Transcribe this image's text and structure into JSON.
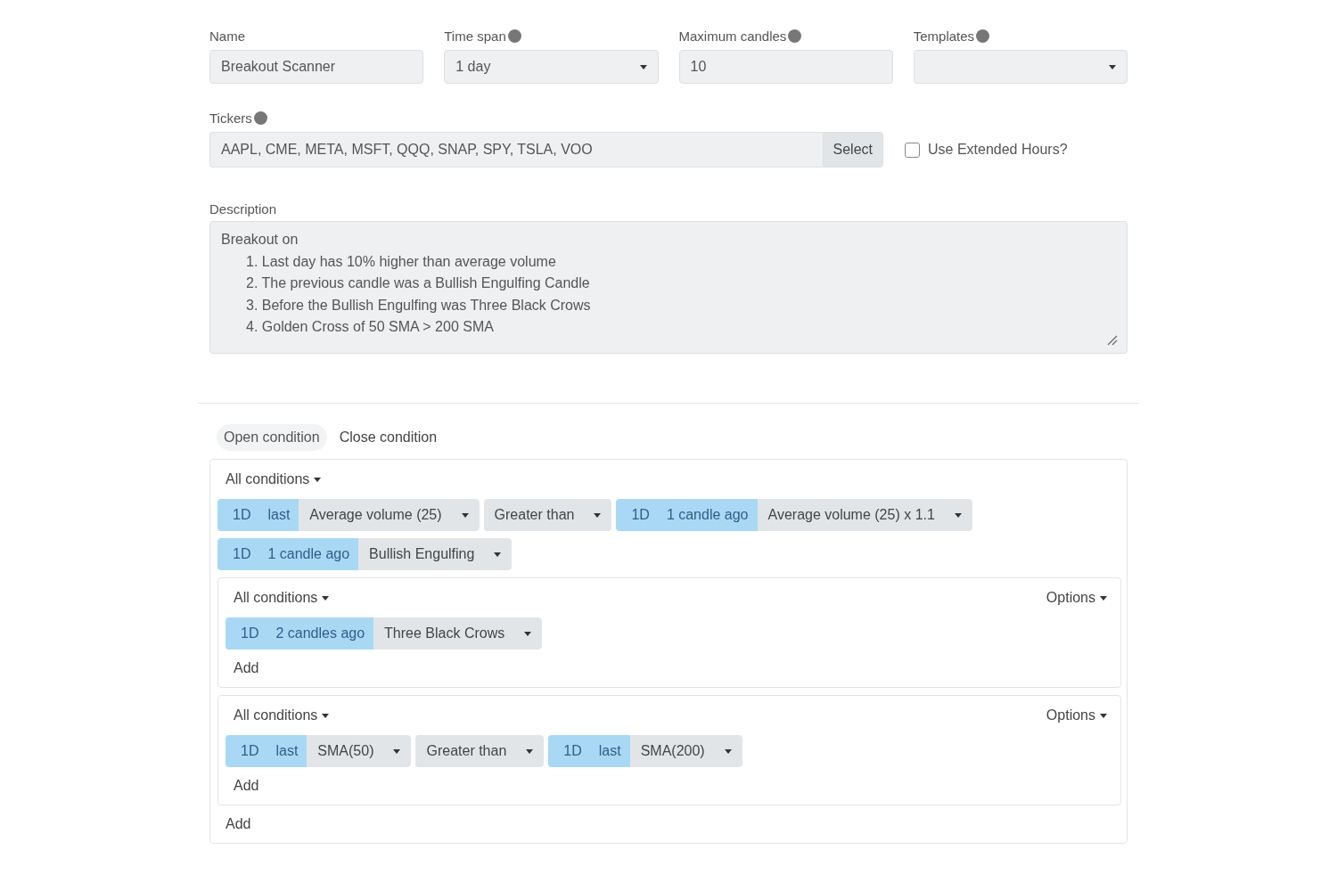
{
  "fields": [
    {
      "label": "Name",
      "kind": "text",
      "value": "Breakout Scanner",
      "help": false
    },
    {
      "label": "Time span",
      "kind": "select",
      "value": "1 day",
      "help": true
    },
    {
      "label": "Maximum candles",
      "kind": "text",
      "value": "10",
      "help": true
    },
    {
      "label": "Templates",
      "kind": "select",
      "help": true
    }
  ],
  "tickers": {
    "label": "Tickers",
    "value": "AAPL, CME, META, MSFT, QQQ, SNAP, SPY, TSLA, VOO",
    "button": "Select"
  },
  "extended_hours": {
    "label": "Use Extended Hours?",
    "checked": false
  },
  "description": {
    "label": "Description",
    "intro": "Breakout on",
    "items": [
      "1. Last day has 10% higher than average volume",
      "2. The previous candle was a Bullish Engulfing Candle",
      "3. Before the Bullish Engulfing was Three Black Crows",
      "4. Golden Cross of 50 SMA > 200 SMA"
    ]
  },
  "tabs": [
    {
      "label": "Open condition",
      "selected": true
    },
    {
      "label": "Close condition",
      "selected": false
    }
  ],
  "root": {
    "mode": "All conditions",
    "rows": [
      [
        {
          "kind": "indicator",
          "timeframe": "1D",
          "offset": "last",
          "value": "Average volume (25)"
        },
        {
          "kind": "operator",
          "value": "Greater than"
        },
        {
          "kind": "indicator",
          "timeframe": "1D",
          "offset": "1 candle ago",
          "value": "Average volume (25) x 1.1"
        }
      ],
      [
        {
          "kind": "indicator",
          "timeframe": "1D",
          "offset": "1 candle ago",
          "value": "Bullish Engulfing"
        }
      ]
    ],
    "groups": [
      {
        "mode": "All conditions",
        "options": "Options",
        "rows": [
          [
            {
              "kind": "indicator",
              "timeframe": "1D",
              "offset": "2 candles ago",
              "value": "Three Black Crows"
            }
          ]
        ],
        "add": "Add"
      },
      {
        "mode": "All conditions",
        "options": "Options",
        "rows": [
          [
            {
              "kind": "indicator",
              "timeframe": "1D",
              "offset": "last",
              "value": "SMA(50)"
            },
            {
              "kind": "operator",
              "value": "Greater than"
            },
            {
              "kind": "indicator",
              "timeframe": "1D",
              "offset": "last",
              "value": "SMA(200)"
            }
          ]
        ],
        "add": "Add"
      }
    ],
    "add": "Add"
  }
}
